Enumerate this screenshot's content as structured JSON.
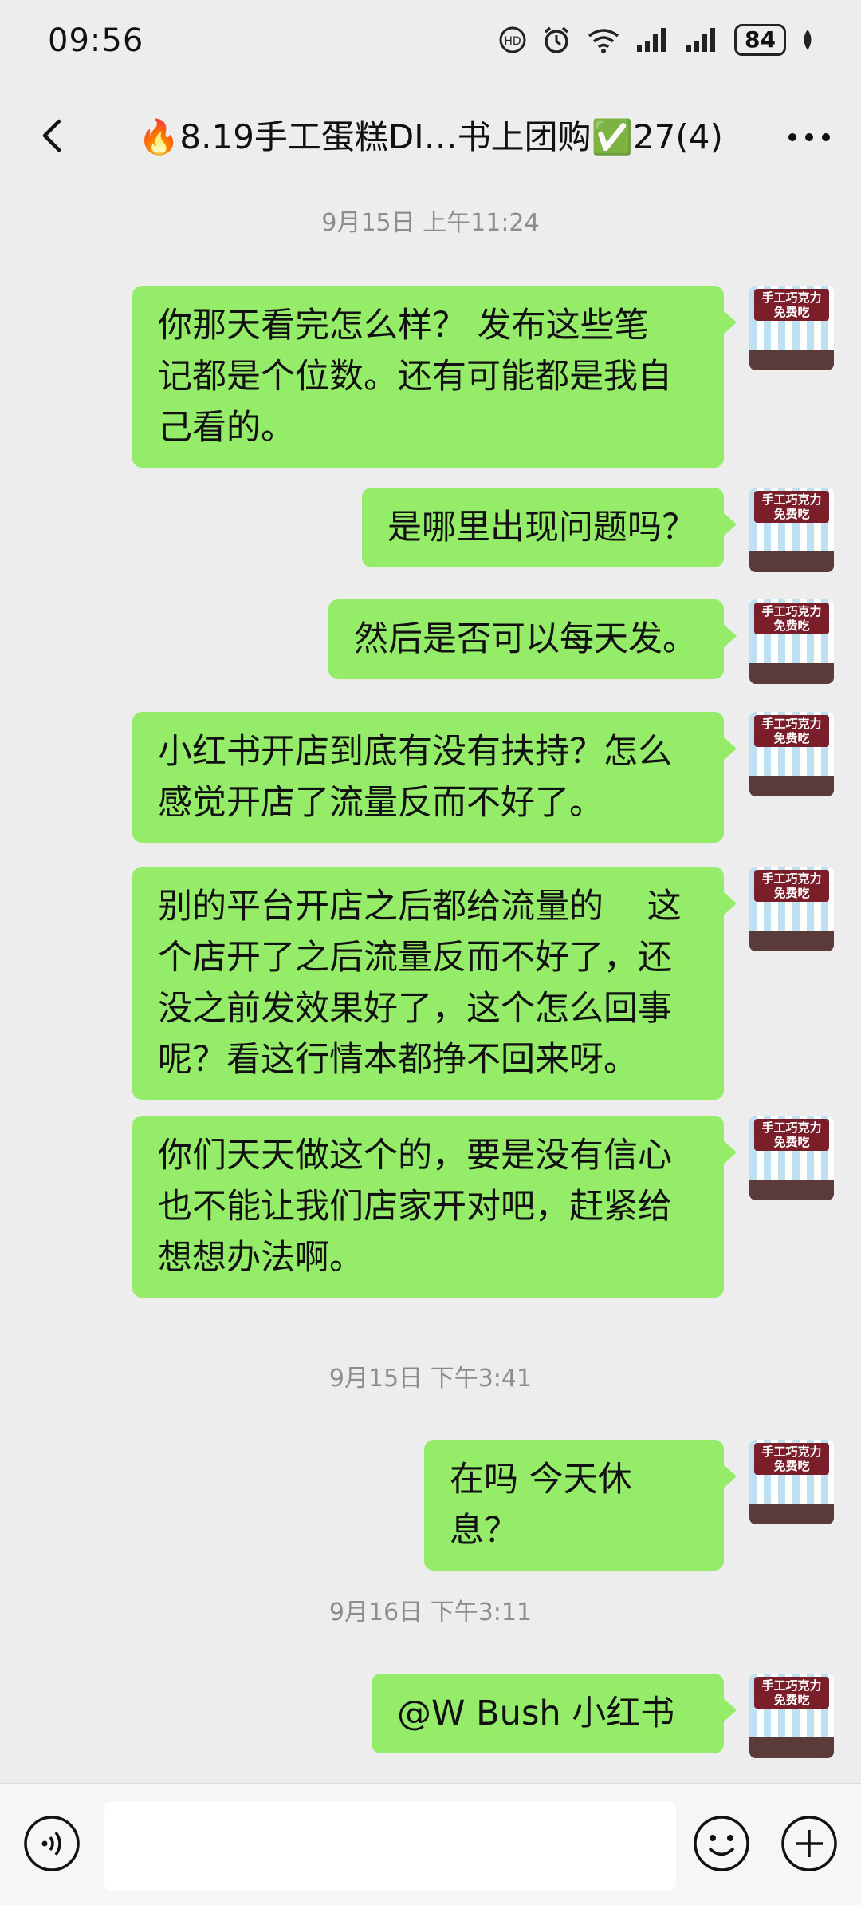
{
  "status": {
    "time": "09:56",
    "battery": "84"
  },
  "chat": {
    "title": "🔥8.19手工蛋糕DI…书上团购✅27(4)"
  },
  "avatar": {
    "title_line1": "手工巧克力",
    "title_line2": "免费吃"
  },
  "timestamps": [
    "9月15日 上午11:24",
    "9月15日 下午3:41",
    "9月16日 下午3:11"
  ],
  "messages": [
    {
      "text": "你那天看完怎么样？ 发布这些笔\n记都是个位数。还有可能都是我自\n己看的。"
    },
    {
      "text": "是哪里出现问题吗？"
    },
    {
      "text": "然后是否可以每天发。"
    },
    {
      "text": "小红书开店到底有没有扶持？怎么\n感觉开店了流量反而不好了。"
    },
    {
      "text": "别的平台开店之后都给流量的    这\n个店开了之后流量反而不好了，还\n没之前发效果好了，这个怎么回事\n呢？看这行情本都挣不回来呀。"
    },
    {
      "text": "你们天天做这个的，要是没有信心\n也不能让我们店家开对吧，赶紧给\n想想办法啊。"
    },
    {
      "text": "在吗 今天休息？"
    },
    {
      "text": "@W Bush 小红书"
    }
  ],
  "input": {
    "placeholder": ""
  },
  "colors": {
    "bubble": "#95ec69",
    "background": "#ededed"
  }
}
